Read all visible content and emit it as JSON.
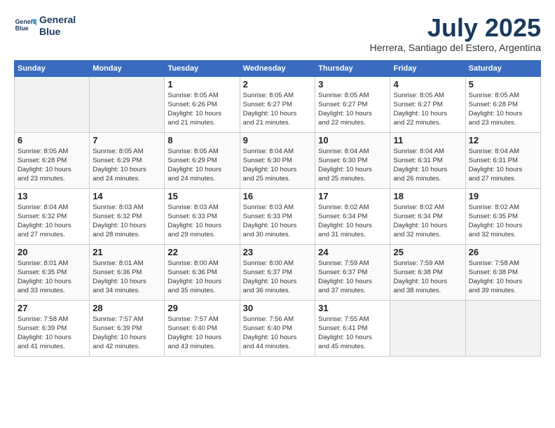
{
  "header": {
    "logo_line1": "General",
    "logo_line2": "Blue",
    "month": "July 2025",
    "location": "Herrera, Santiago del Estero, Argentina"
  },
  "weekdays": [
    "Sunday",
    "Monday",
    "Tuesday",
    "Wednesday",
    "Thursday",
    "Friday",
    "Saturday"
  ],
  "weeks": [
    [
      {
        "day": "",
        "detail": ""
      },
      {
        "day": "",
        "detail": ""
      },
      {
        "day": "1",
        "detail": "Sunrise: 8:05 AM\nSunset: 6:26 PM\nDaylight: 10 hours\nand 21 minutes."
      },
      {
        "day": "2",
        "detail": "Sunrise: 8:05 AM\nSunset: 6:27 PM\nDaylight: 10 hours\nand 21 minutes."
      },
      {
        "day": "3",
        "detail": "Sunrise: 8:05 AM\nSunset: 6:27 PM\nDaylight: 10 hours\nand 22 minutes."
      },
      {
        "day": "4",
        "detail": "Sunrise: 8:05 AM\nSunset: 6:27 PM\nDaylight: 10 hours\nand 22 minutes."
      },
      {
        "day": "5",
        "detail": "Sunrise: 8:05 AM\nSunset: 6:28 PM\nDaylight: 10 hours\nand 23 minutes."
      }
    ],
    [
      {
        "day": "6",
        "detail": "Sunrise: 8:05 AM\nSunset: 6:28 PM\nDaylight: 10 hours\nand 23 minutes."
      },
      {
        "day": "7",
        "detail": "Sunrise: 8:05 AM\nSunset: 6:29 PM\nDaylight: 10 hours\nand 24 minutes."
      },
      {
        "day": "8",
        "detail": "Sunrise: 8:05 AM\nSunset: 6:29 PM\nDaylight: 10 hours\nand 24 minutes."
      },
      {
        "day": "9",
        "detail": "Sunrise: 8:04 AM\nSunset: 6:30 PM\nDaylight: 10 hours\nand 25 minutes."
      },
      {
        "day": "10",
        "detail": "Sunrise: 8:04 AM\nSunset: 6:30 PM\nDaylight: 10 hours\nand 25 minutes."
      },
      {
        "day": "11",
        "detail": "Sunrise: 8:04 AM\nSunset: 6:31 PM\nDaylight: 10 hours\nand 26 minutes."
      },
      {
        "day": "12",
        "detail": "Sunrise: 8:04 AM\nSunset: 6:31 PM\nDaylight: 10 hours\nand 27 minutes."
      }
    ],
    [
      {
        "day": "13",
        "detail": "Sunrise: 8:04 AM\nSunset: 6:32 PM\nDaylight: 10 hours\nand 27 minutes."
      },
      {
        "day": "14",
        "detail": "Sunrise: 8:03 AM\nSunset: 6:32 PM\nDaylight: 10 hours\nand 28 minutes."
      },
      {
        "day": "15",
        "detail": "Sunrise: 8:03 AM\nSunset: 6:33 PM\nDaylight: 10 hours\nand 29 minutes."
      },
      {
        "day": "16",
        "detail": "Sunrise: 8:03 AM\nSunset: 6:33 PM\nDaylight: 10 hours\nand 30 minutes."
      },
      {
        "day": "17",
        "detail": "Sunrise: 8:02 AM\nSunset: 6:34 PM\nDaylight: 10 hours\nand 31 minutes."
      },
      {
        "day": "18",
        "detail": "Sunrise: 8:02 AM\nSunset: 6:34 PM\nDaylight: 10 hours\nand 32 minutes."
      },
      {
        "day": "19",
        "detail": "Sunrise: 8:02 AM\nSunset: 6:35 PM\nDaylight: 10 hours\nand 32 minutes."
      }
    ],
    [
      {
        "day": "20",
        "detail": "Sunrise: 8:01 AM\nSunset: 6:35 PM\nDaylight: 10 hours\nand 33 minutes."
      },
      {
        "day": "21",
        "detail": "Sunrise: 8:01 AM\nSunset: 6:36 PM\nDaylight: 10 hours\nand 34 minutes."
      },
      {
        "day": "22",
        "detail": "Sunrise: 8:00 AM\nSunset: 6:36 PM\nDaylight: 10 hours\nand 35 minutes."
      },
      {
        "day": "23",
        "detail": "Sunrise: 8:00 AM\nSunset: 6:37 PM\nDaylight: 10 hours\nand 36 minutes."
      },
      {
        "day": "24",
        "detail": "Sunrise: 7:59 AM\nSunset: 6:37 PM\nDaylight: 10 hours\nand 37 minutes."
      },
      {
        "day": "25",
        "detail": "Sunrise: 7:59 AM\nSunset: 6:38 PM\nDaylight: 10 hours\nand 38 minutes."
      },
      {
        "day": "26",
        "detail": "Sunrise: 7:58 AM\nSunset: 6:38 PM\nDaylight: 10 hours\nand 39 minutes."
      }
    ],
    [
      {
        "day": "27",
        "detail": "Sunrise: 7:58 AM\nSunset: 6:39 PM\nDaylight: 10 hours\nand 41 minutes."
      },
      {
        "day": "28",
        "detail": "Sunrise: 7:57 AM\nSunset: 6:39 PM\nDaylight: 10 hours\nand 42 minutes."
      },
      {
        "day": "29",
        "detail": "Sunrise: 7:57 AM\nSunset: 6:40 PM\nDaylight: 10 hours\nand 43 minutes."
      },
      {
        "day": "30",
        "detail": "Sunrise: 7:56 AM\nSunset: 6:40 PM\nDaylight: 10 hours\nand 44 minutes."
      },
      {
        "day": "31",
        "detail": "Sunrise: 7:55 AM\nSunset: 6:41 PM\nDaylight: 10 hours\nand 45 minutes."
      },
      {
        "day": "",
        "detail": ""
      },
      {
        "day": "",
        "detail": ""
      }
    ]
  ]
}
